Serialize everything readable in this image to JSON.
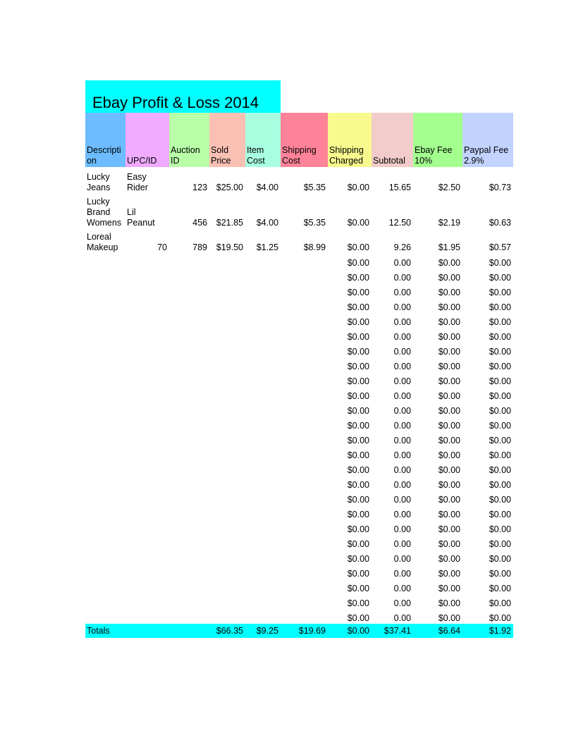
{
  "title": "Ebay Profit & Loss 2014",
  "colors": {
    "title_bg": "#00ffff",
    "totals_bg": "#00ffff",
    "header_description": "#6cbcff",
    "header_upc": "#f0aaff",
    "header_auction": "#b8ffa8",
    "header_sold": "#fbc0b4",
    "header_itemcost": "#a8ffe0",
    "header_shipcost": "#ff8398",
    "header_shipcharged": "#f8fa8e",
    "header_subtotal": "#f2cbcb",
    "header_ebayfee": "#a3ff8e",
    "header_paypalfee": "#c2d3ff"
  },
  "headers": [
    {
      "line1": "Descripti",
      "line2": "on"
    },
    {
      "line1": "",
      "line2": "UPC/ID"
    },
    {
      "line1": "Auction",
      "line2": "ID"
    },
    {
      "line1": "Sold",
      "line2": "Price"
    },
    {
      "line1": "Item",
      "line2": "Cost"
    },
    {
      "line1": "Shipping",
      "line2": "Cost"
    },
    {
      "line1": "Shipping",
      "line2": "Charged"
    },
    {
      "line1": "",
      "line2": "Subtotal"
    },
    {
      "line1": "Ebay Fee",
      "line2": "10%"
    },
    {
      "line1": "Paypal Fee",
      "line2": "2.9%"
    }
  ],
  "rows": [
    {
      "description": [
        "Lucky",
        "Jeans"
      ],
      "upc": [
        "Easy",
        "Rider"
      ],
      "auction_id": "123",
      "sold_price": "$25.00",
      "item_cost": "$4.00",
      "shipping_cost": "$5.35",
      "shipping_charged": "$0.00",
      "subtotal": "15.65",
      "ebay_fee": "$2.50",
      "paypal_fee": "$0.73"
    },
    {
      "description": [
        "Lucky",
        "Brand",
        "Womens"
      ],
      "upc": [
        "Lil",
        "Peanut"
      ],
      "auction_id": "456",
      "sold_price": "$21.85",
      "item_cost": "$4.00",
      "shipping_cost": "$5.35",
      "shipping_charged": "$0.00",
      "subtotal": "12.50",
      "ebay_fee": "$2.19",
      "paypal_fee": "$0.63"
    },
    {
      "description": [
        "Loreal",
        "Makeup"
      ],
      "upc": [
        "70"
      ],
      "auction_id": "789",
      "sold_price": "$19.50",
      "item_cost": "$1.25",
      "shipping_cost": "$8.99",
      "shipping_charged": "$0.00",
      "subtotal": "9.26",
      "ebay_fee": "$1.95",
      "paypal_fee": "$0.57"
    }
  ],
  "empty_row": {
    "shipping_charged": "$0.00",
    "subtotal": "0.00",
    "ebay_fee": "$0.00",
    "paypal_fee": "$0.00"
  },
  "empty_row_count": 25,
  "totals": {
    "label": "Totals",
    "sold_price": "$66.35",
    "item_cost": "$9.25",
    "shipping_cost": "$19.69",
    "shipping_charged": "$0.00",
    "subtotal": "$37.41",
    "ebay_fee": "$6.64",
    "paypal_fee": "$1.92"
  }
}
